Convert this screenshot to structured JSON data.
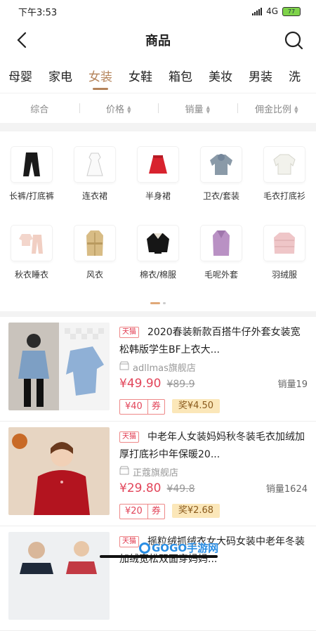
{
  "status": {
    "time": "下午3:53",
    "network": "4G",
    "battery": "77"
  },
  "navbar": {
    "title": "商品"
  },
  "categories": [
    "母婴",
    "家电",
    "女装",
    "女鞋",
    "箱包",
    "美妆",
    "男装",
    "洗"
  ],
  "active_category": "女装",
  "sort": [
    "综合",
    "价格",
    "销量",
    "佣金比例"
  ],
  "subcategories": [
    {
      "label": "长裤/打底裤",
      "icon": "pants-icon"
    },
    {
      "label": "连衣裙",
      "icon": "dress-icon"
    },
    {
      "label": "半身裙",
      "icon": "skirt-icon"
    },
    {
      "label": "卫衣/套装",
      "icon": "hoodie-icon"
    },
    {
      "label": "毛衣打底衫",
      "icon": "sweater-icon"
    },
    {
      "label": "秋衣睡衣",
      "icon": "pajamas-icon"
    },
    {
      "label": "风衣",
      "icon": "trench-coat-icon"
    },
    {
      "label": "棉衣/棉服",
      "icon": "padded-jacket-icon"
    },
    {
      "label": "毛呢外套",
      "icon": "wool-coat-icon"
    },
    {
      "label": "羽绒服",
      "icon": "down-jacket-icon"
    }
  ],
  "products": [
    {
      "badge": "天猫",
      "title": "2020春装新款百搭牛仔外套女装宽松韩版学生BF上衣大...",
      "shop": "adllmas旗舰店",
      "price": "¥49.90",
      "original_price": "¥89.9",
      "sales": "销量19",
      "coupon_value": "¥40",
      "coupon_label": "券",
      "reward": "奖¥4.50"
    },
    {
      "badge": "天猫",
      "title": "中老年人女装妈妈秋冬装毛衣加绒加厚打底衫中年保暖20...",
      "shop": "正蔻旗舰店",
      "price": "¥29.80",
      "original_price": "¥49.8",
      "sales": "销量1624",
      "coupon_value": "¥20",
      "coupon_label": "券",
      "reward": "奖¥2.68"
    },
    {
      "badge": "天猫",
      "title": "摇粒绒抓绒衣女大码女装中老年冬装加绒宽松双面穿妈妈...",
      "shop": "",
      "price": "",
      "original_price": "",
      "sales": "",
      "coupon_value": "",
      "coupon_label": "",
      "reward": ""
    }
  ],
  "watermark": "GOGO手游网"
}
